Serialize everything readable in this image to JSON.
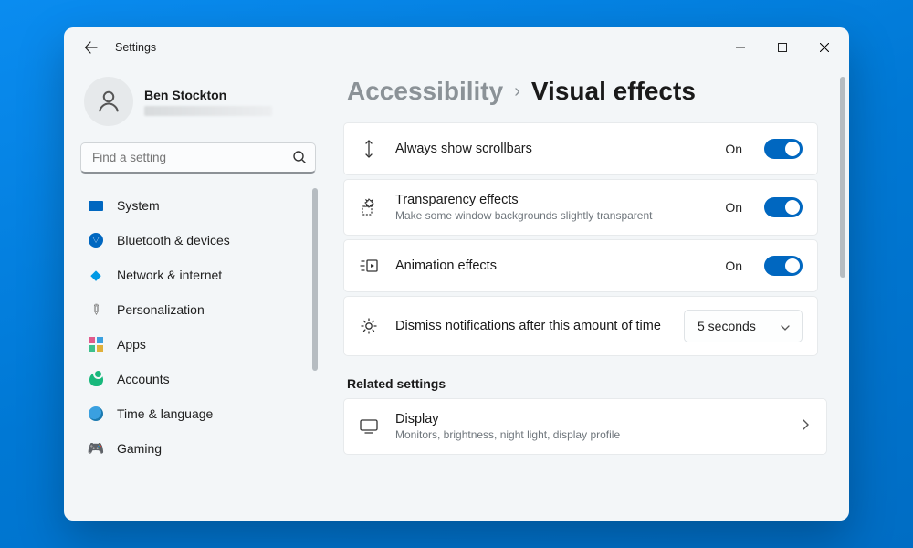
{
  "window": {
    "title": "Settings"
  },
  "profile": {
    "name": "Ben Stockton"
  },
  "search": {
    "placeholder": "Find a setting"
  },
  "sidebar": {
    "items": [
      {
        "label": "System"
      },
      {
        "label": "Bluetooth & devices"
      },
      {
        "label": "Network & internet"
      },
      {
        "label": "Personalization"
      },
      {
        "label": "Apps"
      },
      {
        "label": "Accounts"
      },
      {
        "label": "Time & language"
      },
      {
        "label": "Gaming"
      }
    ]
  },
  "breadcrumb": {
    "parent": "Accessibility",
    "current": "Visual effects"
  },
  "settings": {
    "scrollbars": {
      "title": "Always show scrollbars",
      "state": "On"
    },
    "transparency": {
      "title": "Transparency effects",
      "desc": "Make some window backgrounds slightly transparent",
      "state": "On"
    },
    "animation": {
      "title": "Animation effects",
      "state": "On"
    },
    "dismiss": {
      "title": "Dismiss notifications after this amount of time",
      "value": "5 seconds"
    }
  },
  "related": {
    "heading": "Related settings",
    "display": {
      "title": "Display",
      "desc": "Monitors, brightness, night light, display profile"
    }
  }
}
